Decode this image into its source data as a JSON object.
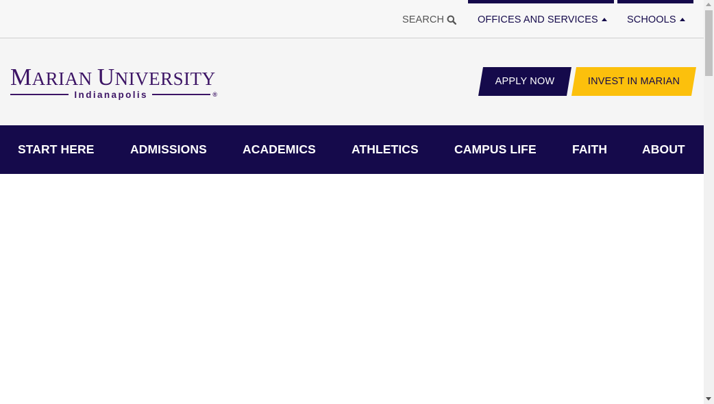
{
  "utility_bar": {
    "search_label": "SEARCH",
    "offices_label": "OFFICES AND SERVICES",
    "schools_label": "SCHOOLS"
  },
  "header": {
    "logo": {
      "name_letters": [
        "M",
        "ARIAN ",
        "U",
        "NIVERSITY"
      ],
      "subtitle": "Indianapolis",
      "registered_mark": "®"
    },
    "apply_label": "APPLY NOW",
    "invest_label": "INVEST IN MARIAN"
  },
  "main_nav": {
    "items": [
      {
        "label": "START HERE"
      },
      {
        "label": "ADMISSIONS"
      },
      {
        "label": "ACADEMICS"
      },
      {
        "label": "ATHLETICS"
      },
      {
        "label": "CAMPUS LIFE"
      },
      {
        "label": "FAITH"
      },
      {
        "label": "ABOUT"
      }
    ]
  },
  "colors": {
    "brand_navy": "#150a4b",
    "brand_gold": "#fcc00c",
    "logo_purple": "#3c1465"
  },
  "icons": {
    "search": "search-icon",
    "offices_caret": "caret-up-icon",
    "schools_caret": "caret-up-icon"
  }
}
